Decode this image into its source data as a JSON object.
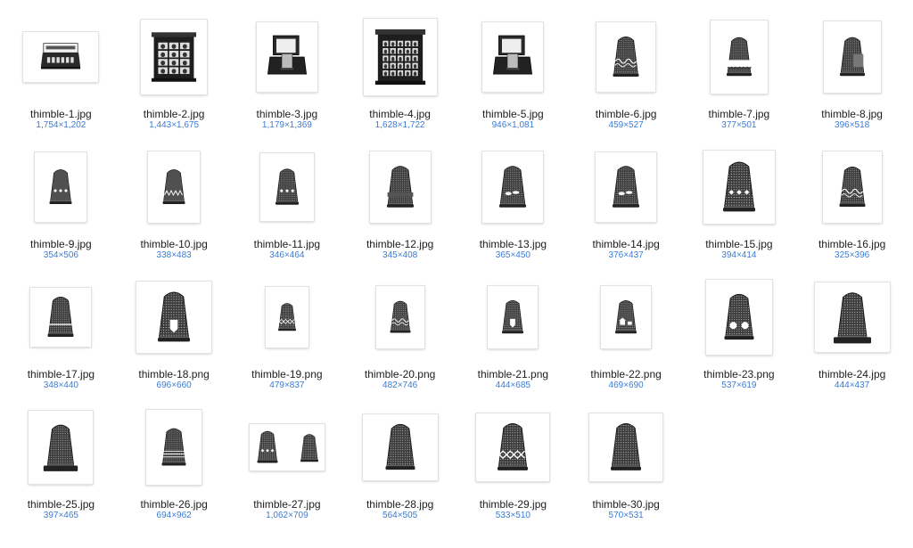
{
  "accent_color": "#3b7bd4",
  "files": [
    {
      "name": "thimble-1.jpg",
      "dims": "1,754×1,202",
      "icon": "thimble-display-box-icon",
      "kind": "box"
    },
    {
      "name": "thimble-2.jpg",
      "dims": "1,443×1,675",
      "icon": "thimble-cabinet-icon",
      "kind": "cabinet"
    },
    {
      "name": "thimble-3.jpg",
      "dims": "1,179×1,369",
      "icon": "thimble-case-icon",
      "kind": "case"
    },
    {
      "name": "thimble-4.jpg",
      "dims": "1,628×1,722",
      "icon": "thimble-cabinet-icon",
      "kind": "cabinet2"
    },
    {
      "name": "thimble-5.jpg",
      "dims": "946×1,081",
      "icon": "thimble-case-icon",
      "kind": "case"
    },
    {
      "name": "thimble-6.jpg",
      "dims": "459×527",
      "icon": "thimble-icon",
      "kind": "thimble",
      "band": "swirl"
    },
    {
      "name": "thimble-7.jpg",
      "dims": "377×501",
      "icon": "thimble-icon",
      "kind": "thimble",
      "band": "scallop"
    },
    {
      "name": "thimble-8.jpg",
      "dims": "396×518",
      "icon": "thimble-icon",
      "kind": "thimble",
      "band": "panel"
    },
    {
      "name": "thimble-9.jpg",
      "dims": "354×506",
      "icon": "thimble-icon",
      "kind": "thimble",
      "band": "dots"
    },
    {
      "name": "thimble-10.jpg",
      "dims": "338×483",
      "icon": "thimble-icon",
      "kind": "thimble",
      "band": "zigzag"
    },
    {
      "name": "thimble-11.jpg",
      "dims": "346×464",
      "icon": "thimble-icon",
      "kind": "thimble",
      "band": "dots"
    },
    {
      "name": "thimble-12.jpg",
      "dims": "345×408",
      "icon": "thimble-icon",
      "kind": "thimble",
      "band": "tall"
    },
    {
      "name": "thimble-13.jpg",
      "dims": "365×450",
      "icon": "thimble-icon",
      "kind": "thimble",
      "band": "leaf"
    },
    {
      "name": "thimble-14.jpg",
      "dims": "376×437",
      "icon": "thimble-icon",
      "kind": "thimble",
      "band": "leaf"
    },
    {
      "name": "thimble-15.jpg",
      "dims": "394×414",
      "icon": "thimble-icon",
      "kind": "thimble",
      "band": "dots"
    },
    {
      "name": "thimble-16.jpg",
      "dims": "325×396",
      "icon": "thimble-icon",
      "kind": "thimble",
      "band": "swirl"
    },
    {
      "name": "thimble-17.jpg",
      "dims": "348×440",
      "icon": "thimble-icon",
      "kind": "thimble",
      "band": "stripe"
    },
    {
      "name": "thimble-18.png",
      "dims": "696×660",
      "icon": "thimble-icon",
      "kind": "thimble",
      "band": "shield"
    },
    {
      "name": "thimble-19.png",
      "dims": "479×837",
      "icon": "thimble-icon",
      "kind": "thimble",
      "band": "diamond"
    },
    {
      "name": "thimble-20.png",
      "dims": "482×746",
      "icon": "thimble-icon",
      "kind": "thimble",
      "band": "swirl"
    },
    {
      "name": "thimble-21.png",
      "dims": "444×685",
      "icon": "thimble-icon",
      "kind": "thimble",
      "band": "shield"
    },
    {
      "name": "thimble-22.png",
      "dims": "469×690",
      "icon": "thimble-icon",
      "kind": "thimble",
      "band": "house"
    },
    {
      "name": "thimble-23.png",
      "dims": "537×619",
      "icon": "thimble-icon",
      "kind": "thimble",
      "band": "apple"
    },
    {
      "name": "thimble-24.jpg",
      "dims": "444×437",
      "icon": "thimble-icon",
      "kind": "thimble",
      "band": "flare"
    },
    {
      "name": "thimble-25.jpg",
      "dims": "397×465",
      "icon": "thimble-icon",
      "kind": "thimble",
      "band": "flare"
    },
    {
      "name": "thimble-26.jpg",
      "dims": "694×962",
      "icon": "thimble-icon",
      "kind": "thimble",
      "band": "ribs"
    },
    {
      "name": "thimble-27.jpg",
      "dims": "1,062×709",
      "icon": "thimble-pair-icon",
      "kind": "pair"
    },
    {
      "name": "thimble-28.jpg",
      "dims": "564×505",
      "icon": "thimble-icon",
      "kind": "thimble",
      "band": "plain"
    },
    {
      "name": "thimble-29.jpg",
      "dims": "533×510",
      "icon": "thimble-icon",
      "kind": "thimble",
      "band": "diamond"
    },
    {
      "name": "thimble-30.jpg",
      "dims": "570×531",
      "icon": "thimble-icon",
      "kind": "thimble",
      "band": "plain"
    }
  ]
}
